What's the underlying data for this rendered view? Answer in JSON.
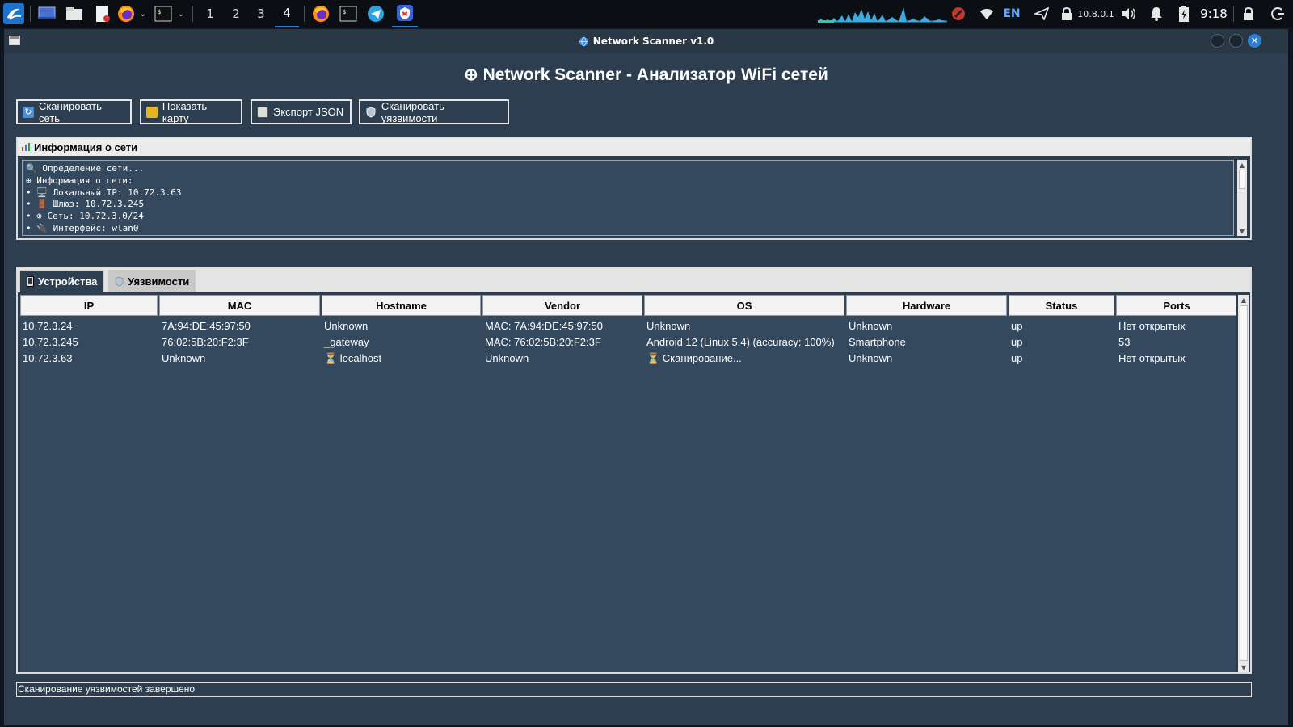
{
  "taskbar": {
    "workspaces": [
      "1",
      "2",
      "3",
      "4"
    ],
    "active_workspace": "4",
    "tray": {
      "language": "EN",
      "ip": "10.8.0.1",
      "clock": "9:18"
    }
  },
  "window": {
    "title": "Network Scanner v1.0",
    "title_icon": "globe-icon"
  },
  "app": {
    "heading": "⊕ Network Scanner - Анализатор WiFi сетей",
    "buttons": {
      "scan": "Сканировать сеть",
      "map": "Показать карту",
      "export": "Экспорт JSON",
      "vuln": "Сканировать уязвимости"
    },
    "info": {
      "header": "Информация о сети",
      "lines": [
        "🔍 Определение сети...",
        "⊕ Информация о сети:",
        "• 🖥️  Локальный IP: 10.72.3.63",
        "• 🚪 Шлюз: 10.72.3.245",
        "• ⊕ Сеть: 10.72.3.0/24",
        "• 🔌 Интерфейс: wlan0"
      ]
    },
    "tabs": {
      "devices": "Устройства",
      "vulns": "Уязвимости"
    },
    "table": {
      "columns": [
        "IP",
        "MAC",
        "Hostname",
        "Vendor",
        "OS",
        "Hardware",
        "Status",
        "Ports"
      ],
      "rows": [
        [
          "10.72.3.24",
          "7A:94:DE:45:97:50",
          "Unknown",
          "MAC: 7A:94:DE:45:97:50",
          "Unknown",
          "Unknown",
          "up",
          "Нет открытых"
        ],
        [
          "10.72.3.245",
          "76:02:5B:20:F2:3F",
          "_gateway",
          "MAC: 76:02:5B:20:F2:3F",
          "Android 12 (Linux 5.4) (accuracy: 100%)",
          "Smartphone",
          "up",
          "53"
        ],
        [
          "10.72.3.63",
          "Unknown",
          "⏳ localhost",
          "Unknown",
          "⏳ Сканирование...",
          "Unknown",
          "up",
          "Нет открытых"
        ]
      ]
    },
    "status": "Сканирование уязвимостей завершено"
  }
}
